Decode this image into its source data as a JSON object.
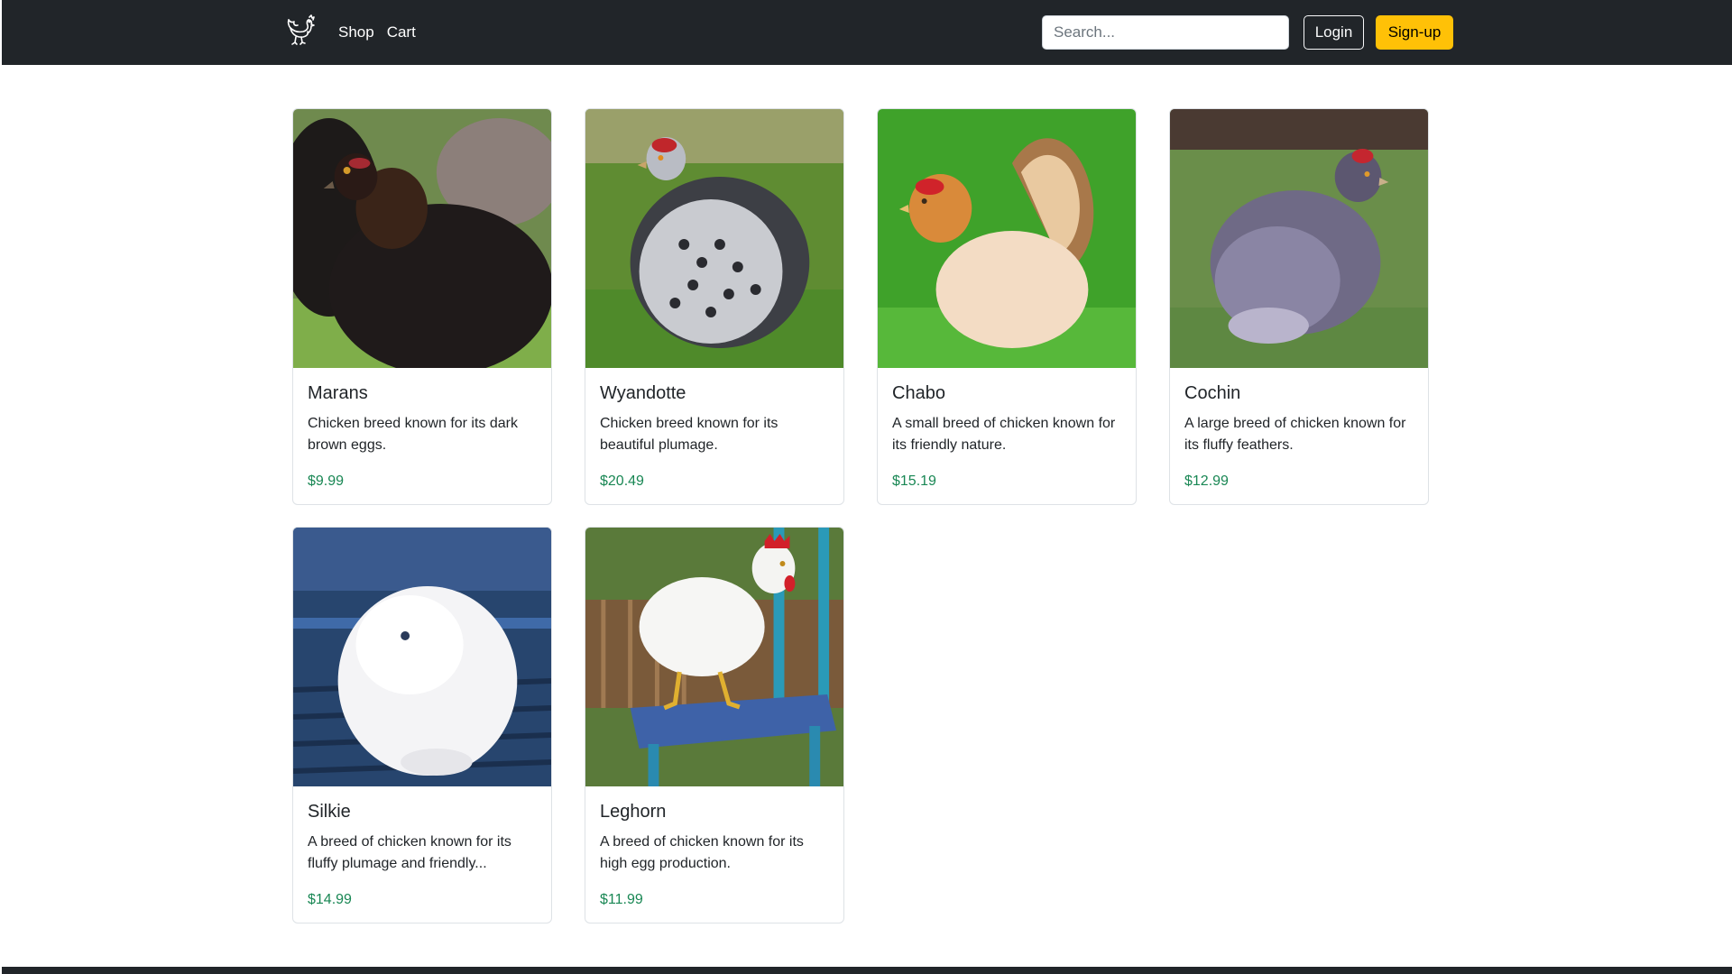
{
  "nav": {
    "brand_icon": "chicken-logo-icon",
    "links": [
      "Shop",
      "Cart"
    ],
    "search_placeholder": "Search...",
    "login_label": "Login",
    "signup_label": "Sign-up"
  },
  "products": [
    {
      "name": "Marans",
      "description": "Chicken breed known for its dark brown eggs.",
      "price": "$9.99",
      "image": "marans-photo"
    },
    {
      "name": "Wyandotte",
      "description": "Chicken breed known for its beautiful plumage.",
      "price": "$20.49",
      "image": "wyandotte-photo"
    },
    {
      "name": "Chabo",
      "description": "A small breed of chicken known for its friendly nature.",
      "price": "$15.19",
      "image": "chabo-photo"
    },
    {
      "name": "Cochin",
      "description": "A large breed of chicken known for its fluffy feathers.",
      "price": "$12.99",
      "image": "cochin-photo"
    },
    {
      "name": "Silkie",
      "description": "A breed of chicken known for its fluffy plumage and friendly...",
      "price": "$14.99",
      "image": "silkie-photo"
    },
    {
      "name": "Leghorn",
      "description": "A breed of chicken known for its high egg production.",
      "price": "$11.99",
      "image": "leghorn-photo"
    }
  ],
  "colors": {
    "navbar": "#212529",
    "price": "#198754",
    "signup": "#ffc107"
  }
}
